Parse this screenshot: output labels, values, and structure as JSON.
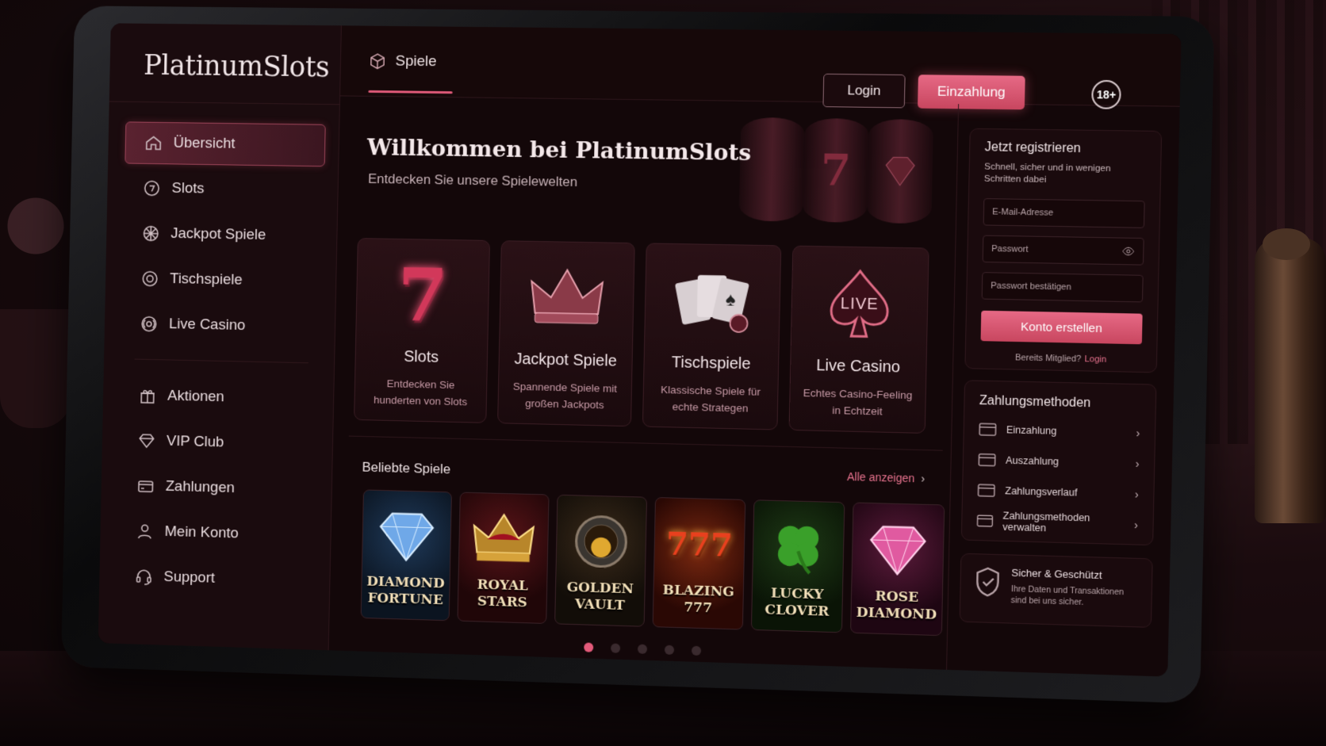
{
  "app": {
    "logo": "PlatinumSlots"
  },
  "sidebar": {
    "primary": [
      {
        "label": "Übersicht",
        "icon": "home-icon",
        "active": true
      },
      {
        "label": "Slots",
        "icon": "slots-icon"
      },
      {
        "label": "Jackpot Spiele",
        "icon": "jackpot-icon"
      },
      {
        "label": "Tischspiele",
        "icon": "chip-icon"
      },
      {
        "label": "Live Casino",
        "icon": "live-icon"
      }
    ],
    "secondary": [
      {
        "label": "Aktionen",
        "icon": "gift-icon"
      },
      {
        "label": "VIP Club",
        "icon": "diamond-icon"
      },
      {
        "label": "Zahlungen",
        "icon": "card-icon"
      },
      {
        "label": "Mein Konto",
        "icon": "user-icon"
      },
      {
        "label": "Support",
        "icon": "headset-icon"
      }
    ]
  },
  "topbar": {
    "tab_label": "Spiele",
    "login_label": "Login",
    "deposit_label": "Einzahlung",
    "age_badge": "18+"
  },
  "hero": {
    "title": "Willkommen bei PlatinumSlots",
    "subtitle": "Entdecken Sie unsere Spielewelten",
    "reel_symbol": "7"
  },
  "categories": [
    {
      "name": "Slots",
      "desc": "Entdecken Sie hunderten von Slots"
    },
    {
      "name": "Jackpot Spiele",
      "desc": "Spannende Spiele mit großen Jackpots"
    },
    {
      "name": "Tischspiele",
      "desc": "Klassische Spiele für echte Strategen"
    },
    {
      "name": "Live Casino",
      "desc": "Echtes Casino-Feeling in Echtzeit",
      "badge": "LIVE"
    }
  ],
  "popular": {
    "title": "Beliebte Spiele",
    "view_all": "Alle anzeigen",
    "games": [
      {
        "title": "DIAMOND FORTUNE"
      },
      {
        "title": "ROYAL STARS"
      },
      {
        "title": "GOLDEN VAULT"
      },
      {
        "title": "BLAZING 777",
        "art_text": "777"
      },
      {
        "title": "LUCKY CLOVER"
      },
      {
        "title": "ROSE DIAMOND"
      }
    ],
    "pages": 5,
    "current_page": 1
  },
  "register": {
    "title": "Jetzt registrieren",
    "subtitle": "Schnell, sicher und in wenigen Schritten dabei",
    "email_placeholder": "E-Mail-Adresse",
    "password_placeholder": "Passwort",
    "confirm_placeholder": "Passwort bestätigen",
    "submit_label": "Konto erstellen",
    "member_text": "Bereits Mitglied?",
    "member_link": "Login"
  },
  "payments": {
    "title": "Zahlungsmethoden",
    "items": [
      "Einzahlung",
      "Auszahlung",
      "Zahlungsverlauf",
      "Zahlungsmethoden verwalten"
    ]
  },
  "security": {
    "title": "Sicher & Geschützt",
    "text": "Ihre Daten und Transaktionen sind bei uns sicher."
  },
  "colors": {
    "accent": "#e35a7a",
    "background": "#130709",
    "panel": "#1a0a0d"
  }
}
